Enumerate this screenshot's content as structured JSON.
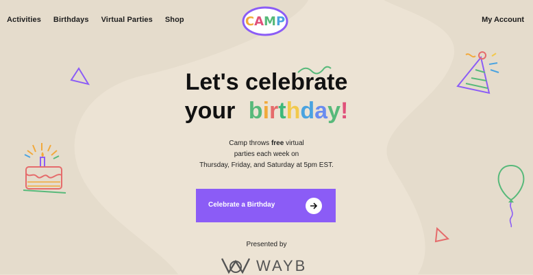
{
  "nav": {
    "links": [
      "Activities",
      "Birthdays",
      "Virtual Parties",
      "Shop"
    ],
    "account": "My Account"
  },
  "logo": {
    "letters": [
      "C",
      "A",
      "M",
      "P"
    ],
    "colors": [
      "#f2a93b",
      "#e0517a",
      "#57b97a",
      "#4aa3e0"
    ]
  },
  "hero": {
    "line1": "Let's celebrate",
    "line2_prefix": "your",
    "line2_colored": [
      "b",
      "i",
      "r",
      "t",
      "h",
      "d",
      "a",
      "y",
      "!"
    ],
    "line2_colors": [
      "#57b97a",
      "#f2a93b",
      "#e56b6b",
      "#3db87a",
      "#f2c94c",
      "#4aa3e0",
      "#6a8cf0",
      "#57b97a",
      "#e0517a"
    ]
  },
  "description": {
    "line1_a": "Camp throws ",
    "line1_bold": "free",
    "line1_b": " virtual",
    "line2": "parties each week on",
    "line3": "Thursday, Friday, and Saturday at 5pm EST."
  },
  "cta": {
    "label": "Celebrate a Birthday",
    "icon": "arrow-right-icon",
    "color": "#8b5cf6"
  },
  "presented": "Presented by",
  "sponsor": {
    "name": "WAYB",
    "icon": "wayb-logo-icon"
  }
}
